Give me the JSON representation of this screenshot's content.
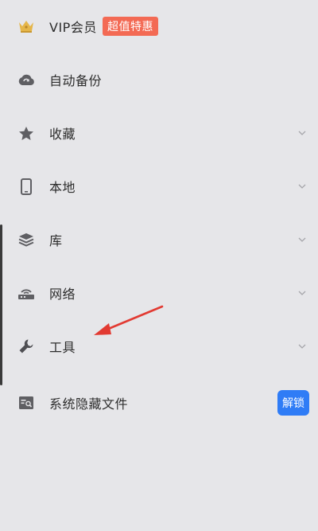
{
  "menu": {
    "vip": {
      "label": "VIP会员",
      "badge": "超值特惠",
      "icon": "crown-icon",
      "badge_color": "#f36a54"
    },
    "items": [
      {
        "label": "自动备份",
        "icon": "cloud-sync-icon"
      },
      {
        "label": "收藏",
        "icon": "star-icon"
      },
      {
        "label": "本地",
        "icon": "phone-icon"
      },
      {
        "label": "库",
        "icon": "layers-icon"
      },
      {
        "label": "网络",
        "icon": "router-icon"
      },
      {
        "label": "工具",
        "icon": "wrench-icon"
      }
    ],
    "hidden_files": {
      "label": "系统隐藏文件",
      "icon": "hidden-file-icon",
      "button": "解锁",
      "button_color": "#2f7cf6"
    }
  },
  "colors": {
    "background": "#e6e6e9",
    "arrow": "#e23a32"
  }
}
